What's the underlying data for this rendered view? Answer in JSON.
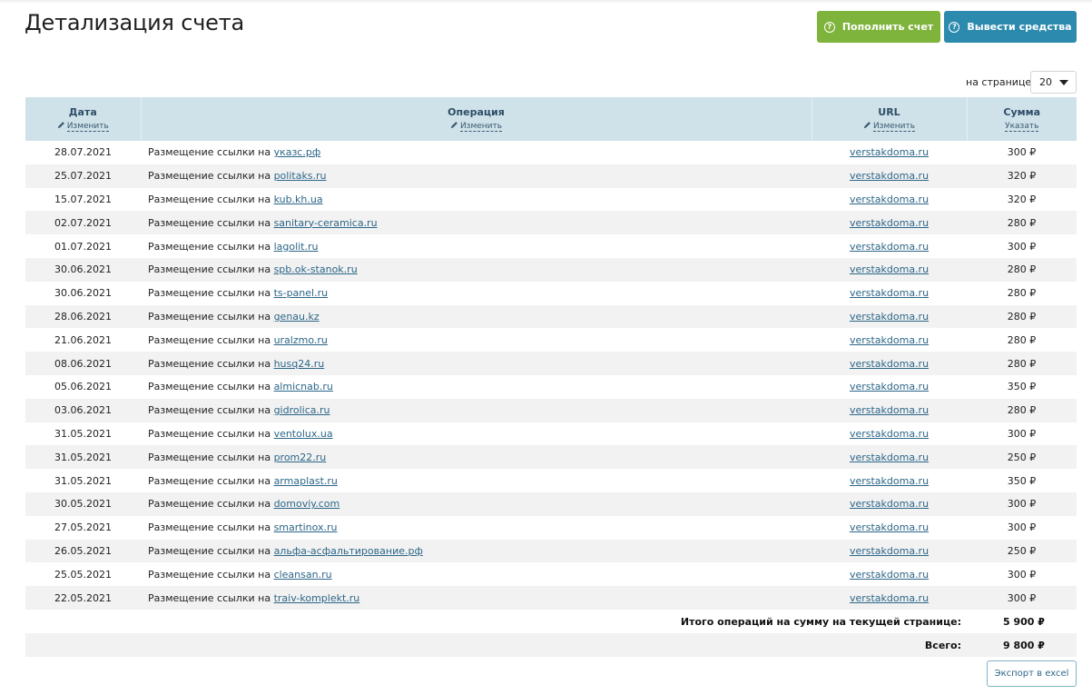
{
  "page": {
    "title": "Детализация счета"
  },
  "actions": {
    "topup_label": "Пополнить счет",
    "withdraw_label": "Вывести средства",
    "export_label": "Экспорт в excel"
  },
  "pagination": {
    "per_page_label": "на странице",
    "per_page_value": "20"
  },
  "table": {
    "columns": [
      {
        "title": "Дата",
        "action": "Изменить"
      },
      {
        "title": "Операция",
        "action": "Изменить"
      },
      {
        "title": "URL",
        "action": "Изменить"
      },
      {
        "title": "Сумма",
        "action": "Указать"
      }
    ],
    "op_prefix": "Размещение ссылки на",
    "rows": [
      {
        "date": "28.07.2021",
        "site": "указс.рф",
        "url": "verstakdoma.ru",
        "sum": "300 ₽"
      },
      {
        "date": "25.07.2021",
        "site": "politaks.ru",
        "url": "verstakdoma.ru",
        "sum": "320 ₽"
      },
      {
        "date": "15.07.2021",
        "site": "kub.kh.ua",
        "url": "verstakdoma.ru",
        "sum": "320 ₽"
      },
      {
        "date": "02.07.2021",
        "site": "sanitary-ceramica.ru",
        "url": "verstakdoma.ru",
        "sum": "280 ₽"
      },
      {
        "date": "01.07.2021",
        "site": "lagolit.ru",
        "url": "verstakdoma.ru",
        "sum": "300 ₽"
      },
      {
        "date": "30.06.2021",
        "site": "spb.ok-stanok.ru",
        "url": "verstakdoma.ru",
        "sum": "280 ₽"
      },
      {
        "date": "30.06.2021",
        "site": "ts-panel.ru",
        "url": "verstakdoma.ru",
        "sum": "280 ₽"
      },
      {
        "date": "28.06.2021",
        "site": "genau.kz",
        "url": "verstakdoma.ru",
        "sum": "280 ₽"
      },
      {
        "date": "21.06.2021",
        "site": "uralzmo.ru",
        "url": "verstakdoma.ru",
        "sum": "280 ₽"
      },
      {
        "date": "08.06.2021",
        "site": "husq24.ru",
        "url": "verstakdoma.ru",
        "sum": "280 ₽"
      },
      {
        "date": "05.06.2021",
        "site": "almicnab.ru",
        "url": "verstakdoma.ru",
        "sum": "350 ₽"
      },
      {
        "date": "03.06.2021",
        "site": "gidrolica.ru",
        "url": "verstakdoma.ru",
        "sum": "280 ₽"
      },
      {
        "date": "31.05.2021",
        "site": "ventolux.ua",
        "url": "verstakdoma.ru",
        "sum": "300 ₽"
      },
      {
        "date": "31.05.2021",
        "site": "prom22.ru",
        "url": "verstakdoma.ru",
        "sum": "250 ₽"
      },
      {
        "date": "31.05.2021",
        "site": "armaplast.ru",
        "url": "verstakdoma.ru",
        "sum": "350 ₽"
      },
      {
        "date": "30.05.2021",
        "site": "domoviy.com",
        "url": "verstakdoma.ru",
        "sum": "300 ₽"
      },
      {
        "date": "27.05.2021",
        "site": "smartinox.ru",
        "url": "verstakdoma.ru",
        "sum": "300 ₽"
      },
      {
        "date": "26.05.2021",
        "site": "альфа-асфальтирование.рф",
        "url": "verstakdoma.ru",
        "sum": "250 ₽"
      },
      {
        "date": "25.05.2021",
        "site": "cleansan.ru",
        "url": "verstakdoma.ru",
        "sum": "300 ₽"
      },
      {
        "date": "22.05.2021",
        "site": "traiv-komplekt.ru",
        "url": "verstakdoma.ru",
        "sum": "300 ₽"
      }
    ]
  },
  "totals": {
    "page_total_label": "Итого операций на сумму на текущей странице:",
    "page_total_value": "5 900 ₽",
    "grand_total_label": "Всего:",
    "grand_total_value": "9 800 ₽"
  },
  "colors": {
    "topup": "#7fb43c",
    "withdraw": "#2c8aae",
    "header_bg": "#cfe2ea",
    "link": "#2c6688"
  }
}
